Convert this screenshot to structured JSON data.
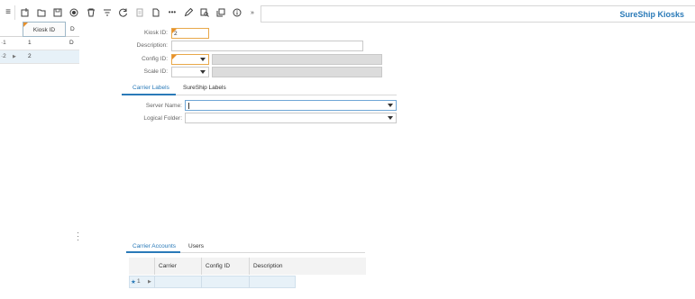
{
  "app": {
    "title": "SureShip Kiosks"
  },
  "toolbar": {
    "icons": [
      {
        "name": "hamburger-menu-icon",
        "glyph": "≡"
      },
      {
        "name": "new-record-icon",
        "glyph": "⊡"
      },
      {
        "name": "open-folder-icon",
        "glyph": "▭"
      },
      {
        "name": "save-icon",
        "glyph": "▣"
      },
      {
        "name": "record-icon",
        "glyph": "◉"
      },
      {
        "name": "delete-icon",
        "glyph": "⌂"
      },
      {
        "name": "filter-icon",
        "glyph": "⩧"
      },
      {
        "name": "refresh-icon",
        "glyph": "↻"
      },
      {
        "name": "document-icon",
        "glyph": "▤"
      },
      {
        "name": "page-icon",
        "glyph": "▯"
      },
      {
        "name": "more-icon",
        "glyph": "•••"
      },
      {
        "name": "edit-icon",
        "glyph": "✎"
      },
      {
        "name": "preview-icon",
        "glyph": "⧉"
      },
      {
        "name": "copy-icon",
        "glyph": "❐"
      },
      {
        "name": "info-icon",
        "glyph": "ⓘ"
      },
      {
        "name": "expand-icon",
        "glyph": "»"
      }
    ]
  },
  "left_grid": {
    "headers": {
      "kiosk_id": "Kiosk ID",
      "d": "D"
    },
    "rows": [
      {
        "num": "1",
        "kiosk_id": "1",
        "d": "D"
      },
      {
        "num": "2",
        "kiosk_id": "2",
        "d": ""
      }
    ]
  },
  "form": {
    "kiosk_id": {
      "label": "Kiosk ID:",
      "value": "2"
    },
    "description": {
      "label": "Description:",
      "value": ""
    },
    "config_id": {
      "label": "Config ID:",
      "value": ""
    },
    "scale_id": {
      "label": "Scale ID:",
      "value": ""
    }
  },
  "tabs_top": [
    "Carrier Labels",
    "SureShip Labels"
  ],
  "carrier_labels": {
    "server_name": {
      "label": "Server Name:",
      "value": ""
    },
    "logical_folder": {
      "label": "Logical Folder:",
      "value": ""
    }
  },
  "tabs_bottom": [
    "Carrier Accounts",
    "Users"
  ],
  "bottom_grid": {
    "headers": [
      "Carrier",
      "Config ID",
      "Description"
    ],
    "row": {
      "num": "1"
    }
  },
  "colors": {
    "accent": "#2a7ab8",
    "required": "#e8902a",
    "selected_row": "#e7f1f8"
  }
}
